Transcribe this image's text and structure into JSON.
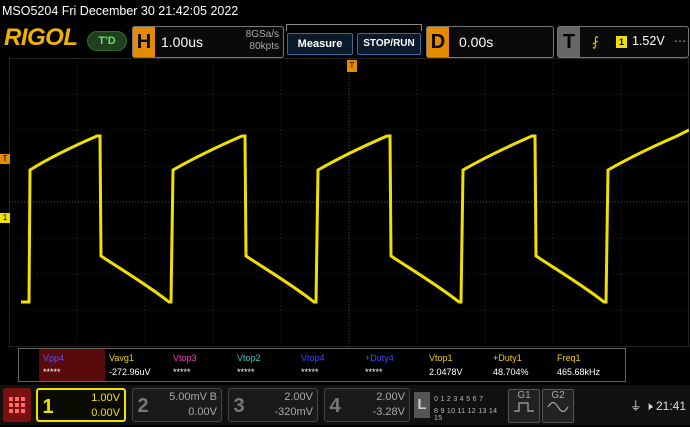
{
  "title": "MSO5204  Fri December 30 21:42:05 2022",
  "header": {
    "logo": "RIGOL",
    "mode": "T'D",
    "horizontal": {
      "badge": "H",
      "timebase": "1.00us",
      "sample_rate": "8GSa/s",
      "memory": "80kpts"
    },
    "measure_label": "Measure",
    "stoprun_label": "STOP/RUN",
    "delay": {
      "badge": "D",
      "value": "0.00s"
    },
    "trigger": {
      "badge": "T",
      "edge": "⨏",
      "source": "1",
      "level": "1.52V"
    }
  },
  "measurements": [
    {
      "label": "Vpp4",
      "value": "*****",
      "color": "#5555ff"
    },
    {
      "label": "Vavg1",
      "value": "-272.96uV",
      "color": "#f0d000"
    },
    {
      "label": "Vtop3",
      "value": "*****",
      "color": "#ff33cc"
    },
    {
      "label": "Vtop2",
      "value": "*****",
      "color": "#33cccc"
    },
    {
      "label": "Vtop4",
      "value": "*****",
      "color": "#4444ff"
    },
    {
      "label": "+Duty4",
      "value": "*****",
      "color": "#4444ff"
    },
    {
      "label": "Vtop1",
      "value": "2.0478V",
      "color": "#f0d000"
    },
    {
      "label": "+Duty1",
      "value": "48.704%",
      "color": "#f0d000"
    },
    {
      "label": "Freq1",
      "value": "465.68kHz",
      "color": "#f0d000"
    }
  ],
  "channels": [
    {
      "num": "1",
      "scale": "1.00V",
      "offset": "0.00V",
      "color": "#f0e000",
      "active": true
    },
    {
      "num": "2",
      "scale": "5.00mV",
      "bw": "B",
      "offset": "0.00V",
      "color": "#888888",
      "active": false
    },
    {
      "num": "3",
      "scale": "2.00V",
      "offset": "-320mV",
      "color": "#888888",
      "active": false
    },
    {
      "num": "4",
      "scale": "2.00V",
      "offset": "-3.28V",
      "color": "#888888",
      "active": false
    }
  ],
  "logic": {
    "badge": "L",
    "row1": "0 1 2 3 4 5 6 7",
    "row2": "8 9 10 11 12 13 14 15"
  },
  "gen1": "G1",
  "gen2": "G2",
  "status": {
    "time": "21:41"
  },
  "markers": {
    "trigger_level": "T",
    "ch1": "1"
  }
}
